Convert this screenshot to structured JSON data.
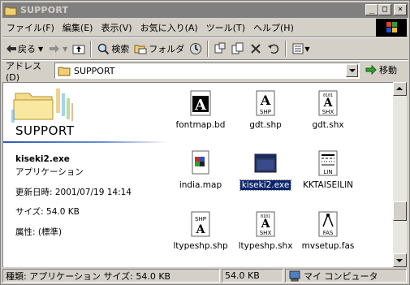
{
  "window": {
    "title": "SUPPORT"
  },
  "title_buttons": {
    "minimize": "_",
    "maximize": "□",
    "close": "×"
  },
  "menu": [
    "ファイル(F)",
    "編集(E)",
    "表示(V)",
    "お気に入り(A)",
    "ツール(T)",
    "ヘルプ(H)"
  ],
  "toolbar": {
    "back": "戻る",
    "search": "検索",
    "folders": "フォルダ"
  },
  "address": {
    "label": "アドレス(D)",
    "value": "SUPPORT",
    "go": "移動"
  },
  "left_pane": {
    "title": "SUPPORT",
    "file_name": "kiseki2.exe",
    "file_type": "アプリケーション",
    "modified": "更新日時: 2001/07/19 14:14",
    "size": "サイズ: 54.0 KB",
    "attributes": "属性: (標準)"
  },
  "files": [
    {
      "name": "fontmap.bd",
      "icon": "font-map-icon",
      "badge": ""
    },
    {
      "name": "gdt.shp",
      "icon": "shp-file-icon",
      "badge": "SHP"
    },
    {
      "name": "gdt.shx",
      "icon": "shx-file-icon",
      "badge": "SHX"
    },
    {
      "name": "india.map",
      "icon": "map-file-icon",
      "badge": ""
    },
    {
      "name": "kiseki2.exe",
      "icon": "exe-window-icon",
      "badge": ""
    },
    {
      "name": "KKTAISEILIN",
      "icon": "lin-file-icon",
      "badge": "LIN"
    },
    {
      "name": "ltypeshp.shp",
      "icon": "shp-file-icon",
      "badge": "SHP"
    },
    {
      "name": "ltypeshp.shx",
      "icon": "shx-file-icon",
      "badge": "SHX"
    },
    {
      "name": "mvsetup.fas",
      "icon": "fas-file-icon",
      "badge": "FAS"
    }
  ],
  "selected_file": "kiseki2.exe",
  "status": {
    "left": "種類: アプリケーション サイズ: 54.0 KB",
    "size": "54.0 KB",
    "location": "マイ コンピュータ"
  },
  "colors": {
    "selection": "#0a246a",
    "titlebar_inactive": "#808080",
    "face": "#d4d0c8"
  }
}
